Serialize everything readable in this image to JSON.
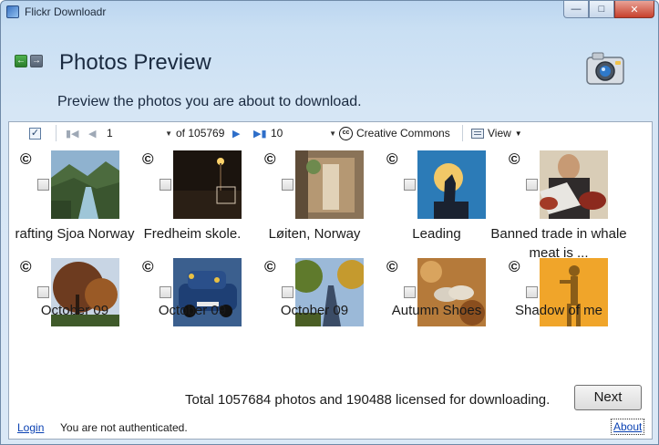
{
  "window": {
    "title": "Flickr Downloadr"
  },
  "header": {
    "title": "Photos Preview",
    "subtitle": "Preview the photos you are about to download."
  },
  "toolbar": {
    "page": "1",
    "of_total": "of 105769",
    "per_page": "10",
    "creative_commons": "Creative Commons",
    "view": "View"
  },
  "photos": [
    {
      "caption": "rafting Sjoa Norway",
      "license": "©"
    },
    {
      "caption": "Fredheim skole.",
      "license": "©"
    },
    {
      "caption": "Løiten, Norway",
      "license": "©"
    },
    {
      "caption": "Leading",
      "license": "©"
    },
    {
      "caption": "Banned trade in whale meat is ...",
      "license": "©"
    },
    {
      "caption": "October 09",
      "license": "©"
    },
    {
      "caption": "October 09",
      "license": "©"
    },
    {
      "caption": "October 09",
      "license": "©"
    },
    {
      "caption": "Autumn Shoes",
      "license": "©"
    },
    {
      "caption": "Shadow of me",
      "license": "©"
    }
  ],
  "footer": {
    "summary": "Total 1057684 photos and 190488 licensed for downloading.",
    "next_label": "Next"
  },
  "status": {
    "login_label": "Login",
    "auth_text": "You are not authenticated.",
    "about_label": "About"
  },
  "colors": {
    "accent": "#2e6ec9",
    "link": "#0b42b3"
  }
}
